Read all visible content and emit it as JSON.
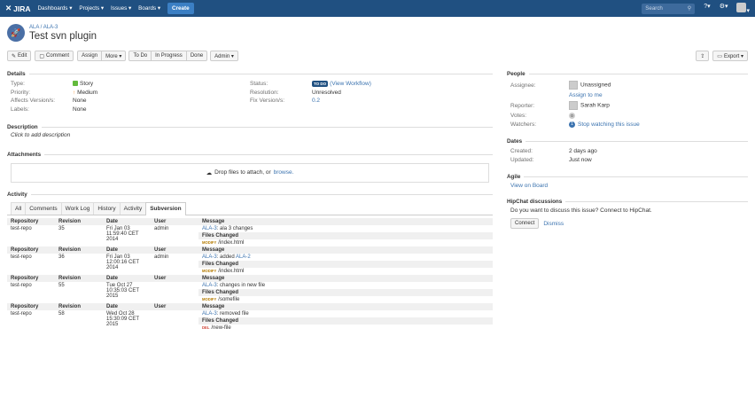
{
  "topbar": {
    "logo": "JIRA",
    "nav": [
      "Dashboards ▾",
      "Projects ▾",
      "Issues ▾",
      "Boards ▾"
    ],
    "create": "Create",
    "search_placeholder": "Search"
  },
  "issue": {
    "project": "ALA",
    "key": "ALA-3",
    "title": "Test svn plugin"
  },
  "toolbar": {
    "edit": "Edit",
    "comment": "Comment",
    "assign": "Assign",
    "more": "More ▾",
    "todo": "To Do",
    "inprogress": "In Progress",
    "done": "Done",
    "admin": "Admin ▾",
    "export": "Export ▾"
  },
  "details": {
    "section": "Details",
    "type_label": "Type:",
    "type": "Story",
    "priority_label": "Priority:",
    "priority": "Medium",
    "affects_label": "Affects Version/s:",
    "affects": "None",
    "labels_label": "Labels:",
    "labels": "None",
    "status_label": "Status:",
    "status": "TO DO",
    "workflow": "(View Workflow)",
    "resolution_label": "Resolution:",
    "resolution": "Unresolved",
    "fix_label": "Fix Version/s:",
    "fix": "0.2"
  },
  "description": {
    "section": "Description",
    "text": "Click to add description"
  },
  "attachments": {
    "section": "Attachments",
    "drop": "Drop files to attach, or",
    "browse": "browse."
  },
  "activity": {
    "section": "Activity",
    "tabs": [
      "All",
      "Comments",
      "Work Log",
      "History",
      "Activity",
      "Subversion"
    ],
    "headers": [
      "Repository",
      "Revision",
      "Date",
      "User",
      "Message"
    ],
    "files_changed": "Files Changed",
    "rows": [
      {
        "repo": "test-repo",
        "rev": "35",
        "date": [
          "Fri Jan 03",
          "11:59:40 CET",
          "2014"
        ],
        "user": "admin",
        "msg_key": "ALA-3",
        "msg": ": ala 3 changes",
        "msg_key2": "",
        "action": "MODIFY",
        "file": "/index.html"
      },
      {
        "repo": "test-repo",
        "rev": "36",
        "date": [
          "Fri Jan 03",
          "12:00:16 CET",
          "2014"
        ],
        "user": "admin",
        "msg_key": "ALA-3",
        "msg": ": added ",
        "msg_key2": "ALA-2",
        "action": "MODIFY",
        "file": "/index.html"
      },
      {
        "repo": "test-repo",
        "rev": "55",
        "date": [
          "Tue Oct 27",
          "10:35:03 CET",
          "2015"
        ],
        "user": "",
        "msg_key": "ALA-3",
        "msg": ": changes in new file",
        "msg_key2": "",
        "action": "MODIFY",
        "file": "/somefile"
      },
      {
        "repo": "test-repo",
        "rev": "58",
        "date": [
          "Wed Oct 28",
          "15:30:09 CET",
          "2015"
        ],
        "user": "",
        "msg_key": "ALA-3",
        "msg": ": removed file",
        "msg_key2": "",
        "action": "DEL",
        "file": "/new-file"
      }
    ]
  },
  "people": {
    "section": "People",
    "assignee_label": "Assignee:",
    "assignee": "Unassigned",
    "assign_me": "Assign to me",
    "reporter_label": "Reporter:",
    "reporter": "Sarah Karp",
    "votes_label": "Votes:",
    "votes": "0",
    "watchers_label": "Watchers:",
    "watch": "Stop watching this issue"
  },
  "dates": {
    "section": "Dates",
    "created_label": "Created:",
    "created": "2 days ago",
    "updated_label": "Updated:",
    "updated": "Just now"
  },
  "agile": {
    "section": "Agile",
    "link": "View on Board"
  },
  "hipchat": {
    "section": "HipChat discussions",
    "text": "Do you want to discuss this issue? Connect to HipChat.",
    "connect": "Connect",
    "dismiss": "Dismiss"
  }
}
